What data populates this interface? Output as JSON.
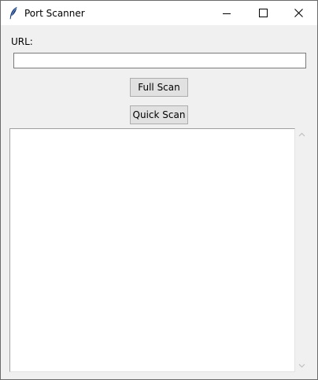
{
  "window": {
    "title": "Port Scanner",
    "app_icon": "feather-icon",
    "controls": [
      "minimize-icon",
      "maximize-icon",
      "close-icon"
    ]
  },
  "form": {
    "url_label": "URL:",
    "url_value": "",
    "url_placeholder": ""
  },
  "buttons": {
    "full_scan": "Full Scan",
    "quick_scan": "Quick Scan"
  },
  "output": {
    "text": ""
  },
  "colors": {
    "window_bg": "#f0f0f0",
    "titlebar_bg": "#ffffff",
    "button_bg": "#e1e1e1",
    "button_border": "#adadad",
    "text_area_bg": "#ffffff"
  }
}
